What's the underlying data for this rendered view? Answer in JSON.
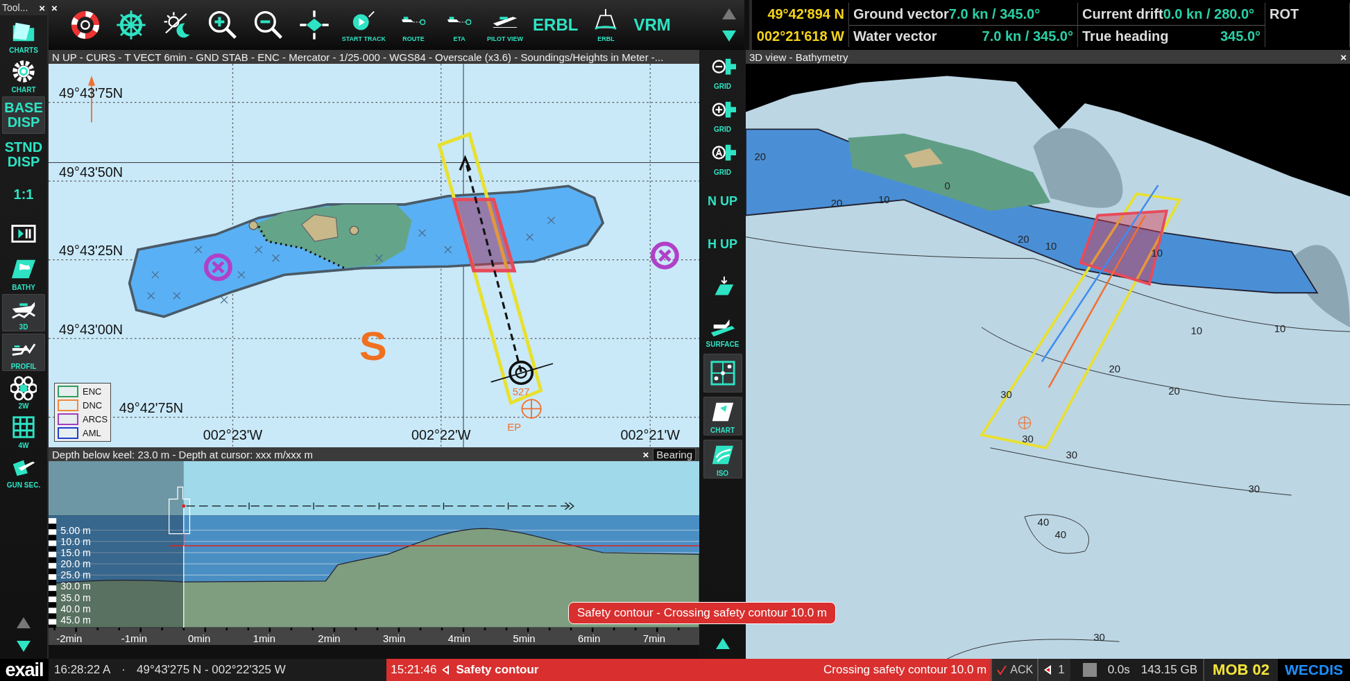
{
  "left_toolbar": {
    "title": "Tool...",
    "close": "×",
    "items": [
      {
        "kind": "icon_label",
        "label": "CHARTS",
        "selected": false
      },
      {
        "kind": "icon_label",
        "label": "CHART",
        "selected": false
      },
      {
        "kind": "text",
        "label": "BASE DISP",
        "selected": true
      },
      {
        "kind": "text",
        "label": "STND DISP",
        "selected": false
      },
      {
        "kind": "text",
        "label": "1:1",
        "selected": false
      },
      {
        "kind": "icon",
        "selected": false
      },
      {
        "kind": "icon_label",
        "label": "BATHY",
        "selected": false
      },
      {
        "kind": "icon_label",
        "label": "3D",
        "selected": true
      },
      {
        "kind": "icon_label",
        "label": "PROFIL",
        "selected": true
      },
      {
        "kind": "icon_label",
        "label": "2W",
        "selected": false
      },
      {
        "kind": "icon_label",
        "label": "4W",
        "selected": false
      },
      {
        "kind": "icon_label",
        "label": "GUN SEC.",
        "selected": false
      }
    ],
    "arrows": [
      {
        "kind": "up",
        "disabled": true
      },
      {
        "kind": "down",
        "disabled": false
      }
    ]
  },
  "top_toolbar": {
    "close": "×",
    "buttons": [
      {
        "kind": "icon"
      },
      {
        "kind": "icon"
      },
      {
        "kind": "icon"
      },
      {
        "kind": "icon"
      },
      {
        "kind": "icon"
      },
      {
        "kind": "icon"
      },
      {
        "kind": "icon_label",
        "label": "START TRACK"
      },
      {
        "kind": "icon_label",
        "label": "ROUTE"
      },
      {
        "kind": "icon_label",
        "label": "ETA"
      },
      {
        "kind": "icon_label",
        "label": "PILOT VIEW"
      },
      {
        "kind": "text",
        "label": "ERBL"
      },
      {
        "kind": "icon_label",
        "label": "ERBL"
      },
      {
        "kind": "text",
        "label": "VRM"
      }
    ],
    "arrows": [
      {
        "kind": "up",
        "disabled": true
      },
      {
        "kind": "down",
        "disabled": false
      }
    ]
  },
  "nav_info": {
    "latitude": "49°42'894 N",
    "longitude": "002°21'618 W",
    "ground_vector": {
      "label": "Ground vector",
      "value": "7.0 kn / 345.0°"
    },
    "current_drift": {
      "label": "Current drift",
      "value": "0.0 kn / 280.0°"
    },
    "rot": {
      "label": "ROT"
    },
    "water_vector": {
      "label": "Water vector",
      "value": "7.0 kn / 345.0°"
    },
    "true_heading": {
      "label": "True heading",
      "value": "345.0°"
    }
  },
  "chart": {
    "header": "N UP - CURS - T VECT 6min - GND STAB - ENC - Mercator - 1/25·000 - WGS84 - Overscale (x3.6) - Soundings/Heights in Meter -...",
    "lat_labels": [
      "49°43'75N",
      "49°43'50N",
      "49°43'25N",
      "49°43'00N",
      "49°42'75N"
    ],
    "lon_labels": [
      "002°23'W",
      "002°22'W",
      "002°21'W"
    ],
    "sea_area": "S",
    "target_label": "527",
    "ep_label": "EP",
    "legend": [
      {
        "label": "ENC",
        "color": "#2e9e5a"
      },
      {
        "label": "DNC",
        "color": "#f08a3c"
      },
      {
        "label": "ARCS",
        "color": "#a040c0"
      },
      {
        "label": "AML",
        "color": "#1f3fd0"
      }
    ]
  },
  "profile": {
    "header": "Depth below keel: 23.0 m - Depth at cursor: xxx m/xxx m",
    "close": "×",
    "mode": "Bearing",
    "depth_labels": [
      "5.00 m",
      "10.0 m",
      "15.0 m",
      "20.0 m",
      "25.0 m",
      "30.0 m",
      "35.0 m",
      "40.0 m",
      "45.0 m"
    ],
    "time_labels": [
      "-2min",
      "-1min",
      "0min",
      "1min",
      "2min",
      "3min",
      "4min",
      "5min",
      "6min",
      "7min"
    ]
  },
  "middle_toolbar": {
    "items": [
      {
        "kind": "icon_label",
        "label": "GRID",
        "selected": false
      },
      {
        "kind": "icon_label",
        "label": "GRID",
        "selected": false
      },
      {
        "kind": "icon_label",
        "label": "GRID",
        "selected": false
      },
      {
        "kind": "text",
        "label": "N UP",
        "selected": false
      },
      {
        "kind": "text",
        "label": "H UP",
        "selected": false
      },
      {
        "kind": "icon",
        "selected": false
      },
      {
        "kind": "icon_label",
        "label": "SURFACE",
        "selected": false
      },
      {
        "kind": "icon",
        "selected": true
      },
      {
        "kind": "icon_label",
        "label": "CHART",
        "selected": true
      },
      {
        "kind": "icon_label",
        "label": "ISO",
        "selected": true
      }
    ],
    "arrows": [
      {
        "kind": "up",
        "disabled": false
      }
    ]
  },
  "view3d": {
    "title": "3D view - Bathymetry",
    "close": "×",
    "contour_labels": [
      "20",
      "0",
      "10",
      "20",
      "20",
      "10",
      "10",
      "10",
      "10",
      "20",
      "20",
      "30",
      "30",
      "30",
      "30",
      "40",
      "40",
      "30"
    ]
  },
  "status_bar": {
    "logo": "exail",
    "time": "16:28:22 A",
    "separator": "·",
    "position": "49°43'275 N - 002°22'325 W",
    "alarm": {
      "time": "15:21:46",
      "title": "Safety contour",
      "message": "Crossing safety contour 10.0 m"
    },
    "ack": "ACK",
    "alarm_count": "1",
    "latency": "0.0s",
    "storage": "143.15 GB",
    "mob": "MOB 02",
    "brand": "WECDIS"
  },
  "tooltip": "Safety contour - Crossing safety contour 10.0 m"
}
